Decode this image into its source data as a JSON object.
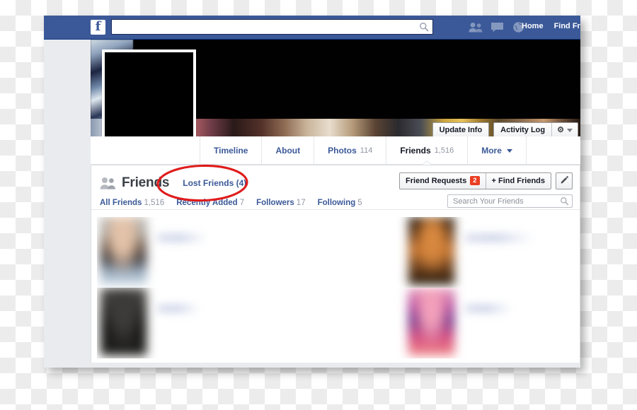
{
  "window": {
    "app": "Facebook",
    "page_background": "#e9ebee"
  },
  "topbar": {
    "logo": "f",
    "search": {
      "value": "",
      "placeholder": ""
    },
    "search_icon": "search-icon",
    "icons": [
      "friend-requests-icon",
      "messages-icon",
      "notifications-globe-icon"
    ],
    "links": [
      "Home",
      "Find Fri"
    ],
    "color": "#3b5998"
  },
  "cover": {
    "profile_photo": "redacted-black",
    "buttons": {
      "update_info": "Update Info",
      "activity_log": "Activity Log",
      "gear": "⚙",
      "caret": "caret-down-icon"
    }
  },
  "profile_nav": {
    "tabs": [
      {
        "label": "Timeline",
        "count": "",
        "active": false
      },
      {
        "label": "About",
        "count": "",
        "active": false
      },
      {
        "label": "Photos",
        "count": "114",
        "active": false
      },
      {
        "label": "Friends",
        "count": "1,516",
        "active": true
      },
      {
        "label": "More",
        "count": "",
        "active": false,
        "caret": true
      }
    ]
  },
  "friends_card": {
    "icon": "friends-icon",
    "title": "Friends",
    "lost_friends_link": "Lost Friends (4)",
    "subnav": [
      {
        "label": "All Friends",
        "count": "1,516"
      },
      {
        "label": "Recently Added",
        "count": "7"
      },
      {
        "label": "Followers",
        "count": "17"
      },
      {
        "label": "Following",
        "count": "5"
      }
    ],
    "actions": {
      "friend_requests": "Friend Requests",
      "friend_requests_badge": "2",
      "find_friends": "+ Find Friends",
      "edit_icon": "pencil-icon"
    },
    "search": {
      "value": "",
      "placeholder": "Search Your Friends"
    },
    "friends": [
      {
        "name": "",
        "avatar": "av-a"
      },
      {
        "name": "",
        "avatar": "av-c"
      },
      {
        "name": "",
        "avatar": "av-b"
      },
      {
        "name": "",
        "avatar": "av-d"
      }
    ]
  },
  "annotation": {
    "shape": "ellipse",
    "color": "#e01b1b",
    "targets": "Lost Friends (4)"
  }
}
